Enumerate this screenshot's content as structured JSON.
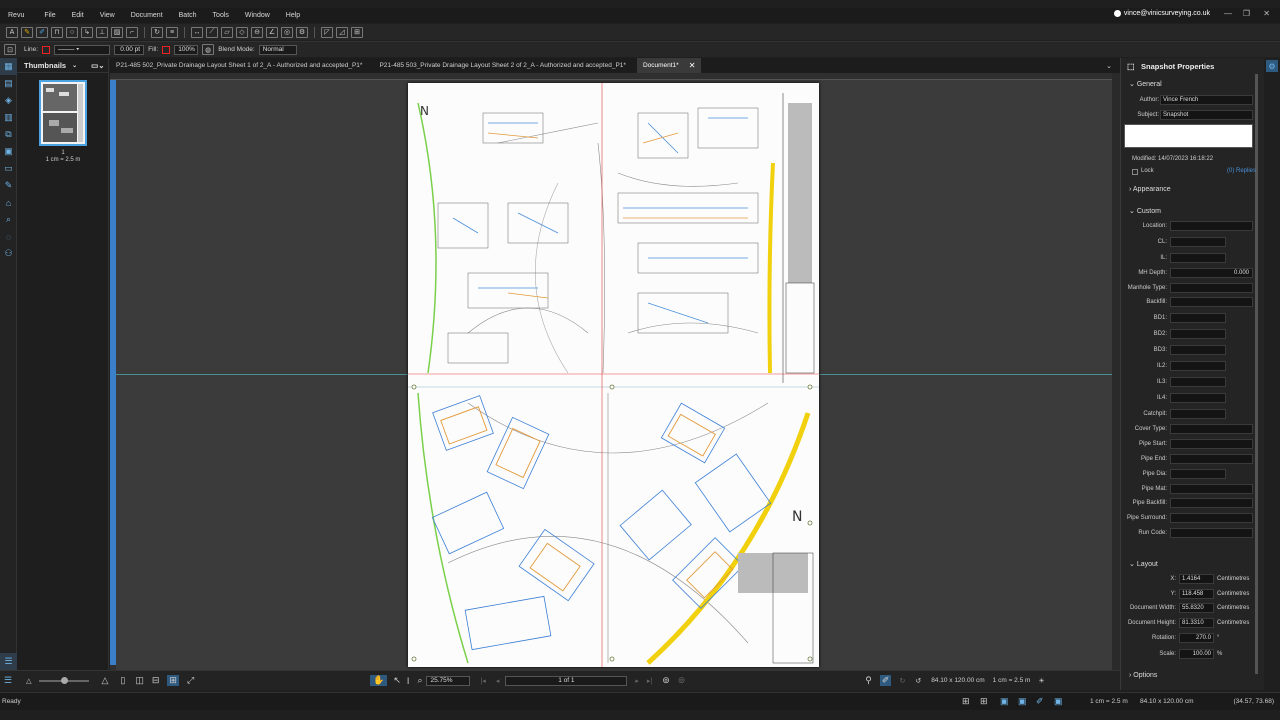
{
  "menu": {
    "items": [
      "Revu",
      "File",
      "Edit",
      "View",
      "Document",
      "Batch",
      "Tools",
      "Window",
      "Help"
    ],
    "user_email": "vince@vinicsurveying.co.uk"
  },
  "toolbar2": {
    "line_label": "Line:",
    "line_weight": "0.00 pt",
    "fill_label": "Fill:",
    "opacity": "100%",
    "blend_label": "Blend Mode:",
    "blend_value": "Normal"
  },
  "thumbnails": {
    "title": "Thumbnails",
    "page_number": "1",
    "page_scale": "1 cm = 2.5 m"
  },
  "tabs": [
    {
      "label": "P21-485 502_Private Drainage Layout Sheet 1 of 2_A - Authorized and accepted_P1*"
    },
    {
      "label": "P21-485 503_Private Drainage Layout Sheet 2 of 2_A - Authorized and accepted_P1*"
    },
    {
      "label": "Document1*"
    }
  ],
  "bottombar": {
    "zoom": "25.75%",
    "page_indicator": "1 of 1",
    "page_size": "84.10 x 120.00 cm",
    "scale": "1 cm = 2.5 m"
  },
  "statusbar": {
    "status": "Ready",
    "scale": "1 cm = 2.5 m",
    "size": "84.10 x 120.00 cm",
    "coords": "(34.57, 73.68)"
  },
  "properties": {
    "title": "Snapshot Properties",
    "general": "General",
    "author_label": "Author:",
    "author": "Vince French",
    "subject_label": "Subject:",
    "subject": "Snapshot",
    "modified": "Modified: 14/07/2023 16:18:22",
    "lock": "Lock",
    "replies": "(0) Replies",
    "appearance": "Appearance",
    "custom": "Custom",
    "custom_fields": [
      {
        "label": "Location:",
        "value": ""
      },
      {
        "label": "CL:",
        "value": ""
      },
      {
        "label": "IL:",
        "value": ""
      },
      {
        "label": "MH Depth:",
        "value": "0.000"
      },
      {
        "label": "Manhole Type:",
        "value": ""
      },
      {
        "label": "Backfill:",
        "value": ""
      },
      {
        "label": "BD1:",
        "value": ""
      },
      {
        "label": "BD2:",
        "value": ""
      },
      {
        "label": "BD3:",
        "value": ""
      },
      {
        "label": "IL2:",
        "value": ""
      },
      {
        "label": "IL3:",
        "value": ""
      },
      {
        "label": "IL4:",
        "value": ""
      },
      {
        "label": "Catchpit:",
        "value": ""
      },
      {
        "label": "Cover Type:",
        "value": ""
      },
      {
        "label": "Pipe Start:",
        "value": ""
      },
      {
        "label": "Pipe End:",
        "value": ""
      },
      {
        "label": "Pipe Dia:",
        "value": ""
      },
      {
        "label": "Pipe Mat:",
        "value": ""
      },
      {
        "label": "Pipe Backfill:",
        "value": ""
      },
      {
        "label": "Pipe Surround:",
        "value": ""
      },
      {
        "label": "Run Code:",
        "value": ""
      }
    ],
    "layout": "Layout",
    "layout_fields": [
      {
        "label": "X:",
        "value": "1.4164",
        "unit": "Centimetres"
      },
      {
        "label": "Y:",
        "value": "118.458",
        "unit": "Centimetres"
      },
      {
        "label": "Document Width:",
        "value": "55.8320",
        "unit": "Centimetres"
      },
      {
        "label": "Document Height:",
        "value": "81.3310",
        "unit": "Centimetres"
      },
      {
        "label": "Rotation:",
        "value": "270.0",
        "unit": "°"
      },
      {
        "label": "Scale:",
        "value": "100.00",
        "unit": "%"
      }
    ],
    "options": "Options"
  }
}
